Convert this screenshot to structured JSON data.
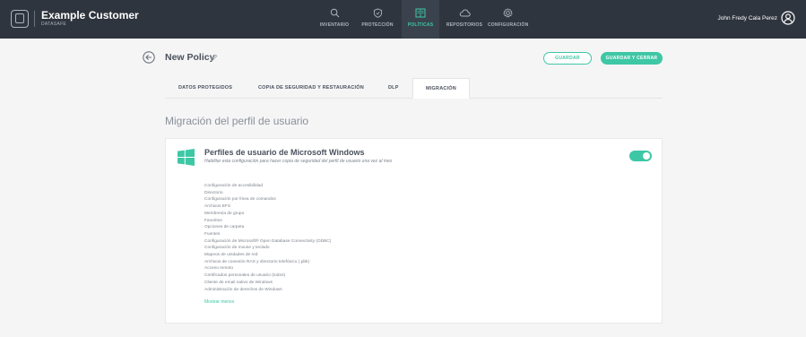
{
  "app": {
    "brand_name": "Example Customer",
    "brand_sub": "DATASAFE",
    "user_name": "John Fredy Cala Perez"
  },
  "nav": [
    {
      "label": "INVENTARIO",
      "icon": "search-icon"
    },
    {
      "label": "PROTECCIÓN",
      "icon": "shield-icon"
    },
    {
      "label": "POLÍTICAS",
      "icon": "policy-icon",
      "active": true
    },
    {
      "label": "REPOSITORIOS",
      "icon": "cloud-icon"
    },
    {
      "label": "CONFIGURACIÓN",
      "icon": "gear-icon"
    }
  ],
  "header": {
    "policy_title": "New Policy",
    "save_label": "GUARDAR",
    "save_close_label": "GUARDAR Y CERRAR"
  },
  "tabs": [
    {
      "label": "DATOS PROTEGIDOS"
    },
    {
      "label": "COPIA DE SEGURIDAD Y RESTAURACIÓN"
    },
    {
      "label": "DLP"
    },
    {
      "label": "MIGRACIÓN",
      "active": true
    }
  ],
  "section": {
    "title": "Migración del perfil de usuario"
  },
  "card": {
    "title": "Perfiles de usuario de Microsoft Windows",
    "subtitle": "Habilitar esta configuración para hacer copia de seguridad del perfil de usuario una vez al mes",
    "enabled": true,
    "items": [
      "Configuración de accesibilidad",
      "Directorio",
      "Configuración por línea de comandos",
      "Archivos EFS",
      "Membresía de grupo",
      "Favoritos",
      "Opciones de carpeta",
      "Fuentes",
      "Configuración de Microsoft® Open Database Connectivity (ODBC)",
      "Configuración de mouse y teclado",
      "Mapeos de unidades de red",
      "Archivos de conexión RAS y directorio telefónico (.pbk)",
      "Acceso remoto",
      "Certificados personales de usuario (todos)",
      "Cliente de email nativo de Windows",
      "Administración de derechos de Windows"
    ],
    "show_less_label": "Mostrar menos"
  },
  "colors": {
    "accent": "#3ec7a5",
    "topbar": "#2f353e",
    "background": "#f5f5f6"
  }
}
